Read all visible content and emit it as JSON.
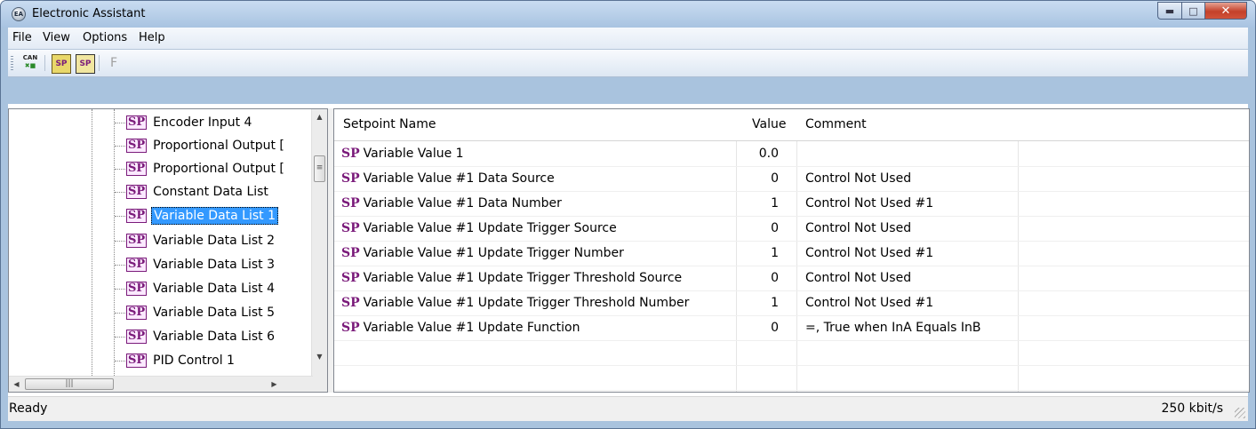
{
  "window": {
    "title": "Electronic Assistant",
    "icon": "ea-app-icon",
    "minimize": "minimize-icon",
    "maximize": "maximize-icon",
    "close": "close-icon"
  },
  "menu": [
    "File",
    "View",
    "Options",
    "Help"
  ],
  "toolbar": {
    "buttons": [
      {
        "name": "can-connect-icon",
        "label": "CAN"
      },
      {
        "name": "sp-open-icon",
        "label": "SP"
      },
      {
        "name": "sp-save-icon",
        "label": "SP"
      },
      {
        "name": "flash-icon",
        "label": "F"
      }
    ]
  },
  "tree": {
    "items": [
      "Encoder Input 4",
      "Proportional Output [",
      "Proportional Output [",
      "Constant Data List",
      "Variable Data List 1",
      "Variable Data List 2",
      "Variable Data List 3",
      "Variable Data List 4",
      "Variable Data List 5",
      "Variable Data List 6",
      "PID Control 1"
    ],
    "selected_index": 4,
    "icon_text": "SP"
  },
  "grid": {
    "columns": [
      "Setpoint Name",
      "Value",
      "Comment"
    ],
    "rows": [
      {
        "name": "Variable Value 1",
        "value": "0.0",
        "comment": ""
      },
      {
        "name": "Variable Value #1 Data Source",
        "value": "0",
        "comment": "Control Not Used"
      },
      {
        "name": "Variable Value #1 Data Number",
        "value": "1",
        "comment": "Control Not Used #1"
      },
      {
        "name": "Variable Value #1 Update Trigger Source",
        "value": "0",
        "comment": "Control Not Used"
      },
      {
        "name": "Variable Value #1 Update Trigger Number",
        "value": "1",
        "comment": "Control Not Used #1"
      },
      {
        "name": "Variable Value #1 Update Trigger Threshold Source",
        "value": "0",
        "comment": "Control Not Used"
      },
      {
        "name": "Variable Value #1 Update Trigger Threshold Number",
        "value": "1",
        "comment": "Control Not Used #1"
      },
      {
        "name": "Variable Value #1 Update Function",
        "value": "0",
        "comment": "=,   True when InA Equals InB"
      }
    ],
    "sp_prefix": "SP"
  },
  "status": {
    "left": "Ready",
    "right": "250 kbit/s"
  }
}
